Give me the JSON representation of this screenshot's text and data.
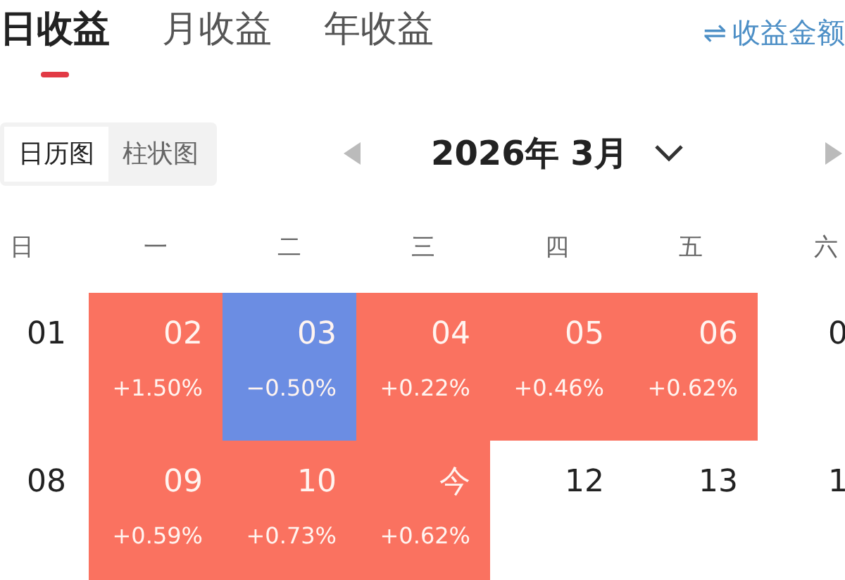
{
  "tabs": [
    {
      "label": "日收益",
      "selected": true
    },
    {
      "label": "月收益",
      "selected": false
    },
    {
      "label": "年收益",
      "selected": false
    }
  ],
  "amount_toggle": {
    "icon": "⇌",
    "label": "收益金额"
  },
  "view_switch": [
    {
      "label": "日历图",
      "selected": true
    },
    {
      "label": "柱状图",
      "selected": false
    }
  ],
  "month": {
    "label": "2026年 3月"
  },
  "weekdays": [
    "日",
    "一",
    "二",
    "三",
    "四",
    "五",
    "六"
  ],
  "weeks": [
    [
      {
        "date": "01"
      },
      {
        "date": "02",
        "change": "+1.50%",
        "color": "#fa7260"
      },
      {
        "date": "03",
        "change": "−0.50%",
        "color": "#6b8de3"
      },
      {
        "date": "04",
        "change": "+0.22%",
        "color": "#fa7260"
      },
      {
        "date": "05",
        "change": "+0.46%",
        "color": "#fa7260"
      },
      {
        "date": "06",
        "change": "+0.62%",
        "color": "#fa7260"
      },
      {
        "date": "0"
      }
    ],
    [
      {
        "date": "08"
      },
      {
        "date": "09",
        "change": "+0.59%",
        "color": "#fa7260"
      },
      {
        "date": "10",
        "change": "+0.73%",
        "color": "#fa7260"
      },
      {
        "date": "今",
        "change": "+0.62%",
        "color": "#fa7260"
      },
      {
        "date": "12"
      },
      {
        "date": "13"
      },
      {
        "date": "1"
      }
    ]
  ]
}
